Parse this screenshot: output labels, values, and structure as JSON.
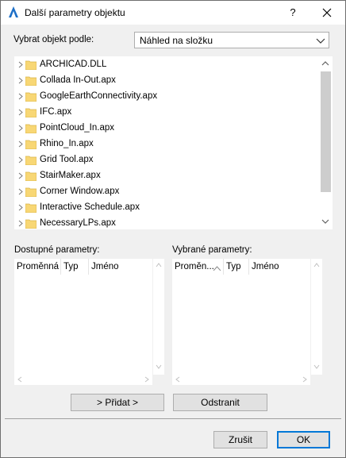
{
  "window": {
    "title": "Další parametry objektu",
    "help_label": "?"
  },
  "selector": {
    "label": "Vybrat objekt podle:",
    "value": "Náhled na složku"
  },
  "tree": {
    "items": [
      {
        "label": "ARCHICAD.DLL"
      },
      {
        "label": "Collada In-Out.apx"
      },
      {
        "label": "GoogleEarthConnectivity.apx"
      },
      {
        "label": "IFC.apx"
      },
      {
        "label": "PointCloud_In.apx"
      },
      {
        "label": "Rhino_In.apx"
      },
      {
        "label": "Grid Tool.apx"
      },
      {
        "label": "StairMaker.apx"
      },
      {
        "label": "Corner Window.apx"
      },
      {
        "label": "Interactive Schedule.apx"
      },
      {
        "label": "NecessaryLPs.apx"
      }
    ]
  },
  "available": {
    "label": "Dostupné parametry:",
    "columns": [
      "Proměnná",
      "Typ",
      "Jméno"
    ]
  },
  "selected": {
    "label": "Vybrané parametry:",
    "columns": [
      "Proměn...",
      "Typ",
      "Jméno"
    ]
  },
  "actions": {
    "add_label": "> Přidat >",
    "remove_label": "Odstranit"
  },
  "footer": {
    "cancel_label": "Zrušit",
    "ok_label": "OK"
  },
  "colors": {
    "folder": "#f8d775",
    "accent": "#0078d7"
  }
}
